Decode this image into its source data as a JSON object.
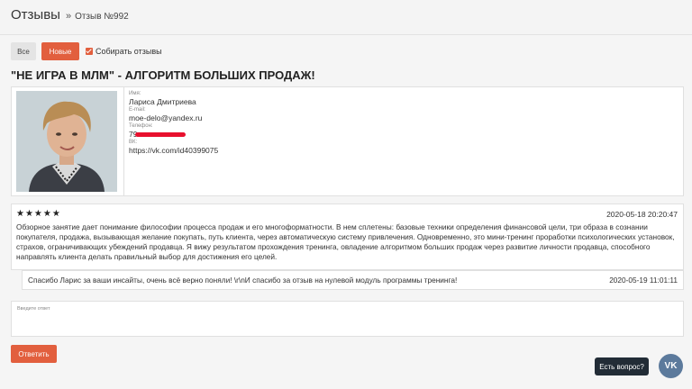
{
  "header": {
    "breadcrumb_root": "Отзывы",
    "breadcrumb_sep": "»",
    "breadcrumb_current": "Отзыв №992"
  },
  "filters": {
    "all_label": "Все",
    "new_label": "Новые",
    "collect_label": "Собирать отзывы",
    "collect_checked": true
  },
  "review_title": "\"НЕ ИГРА В МЛМ\" - АЛГОРИТМ БОЛЬШИХ ПРОДАЖ!",
  "author": {
    "name_label": "Имя:",
    "name": "Лариса Дмитриева",
    "email_label": "E-mail:",
    "email": "moe-delo@yandex.ru",
    "phone_label": "Телефон:",
    "phone": "79",
    "vk_label": "ВК:",
    "vk": "https://vk.com/id40399075"
  },
  "review": {
    "stars": "★★★★★",
    "rating": 5,
    "date": "2020-05-18 20:20:47",
    "text": "Обзорное занятие дает понимание философии процесса продаж и его многоформатности. В нем сплетены: базовые техники определения финансовой цели, три образа в сознании покупателя, продажа, вызывающая желание покупать, путь клиента, через автоматическую систему привлечения. Одновременно, это мини-тренинг проработки психологических установок, страхов, ограничивающих убеждений продавца. Я вижу результатом прохождения тренинга, овладение алгоритмом больших продаж через развитие личности продавца, способного направлять клиента делать правильный выбор для достижения его целей."
  },
  "reply": {
    "text": "Спасибо Ларис за ваши инсайты, очень всё верно поняли! \\r\\nИ спасибо за отзыв на нулевой модуль программы тренинга!",
    "date": "2020-05-19 11:01:11"
  },
  "answer": {
    "placeholder": "Введите ответ",
    "submit_label": "Ответить"
  },
  "widget": {
    "question_label": "Есть вопрос?",
    "vk_label": "VK"
  },
  "colors": {
    "accent": "#e25f3e",
    "vk": "#5c7a9c",
    "tooltip": "#222c36"
  }
}
